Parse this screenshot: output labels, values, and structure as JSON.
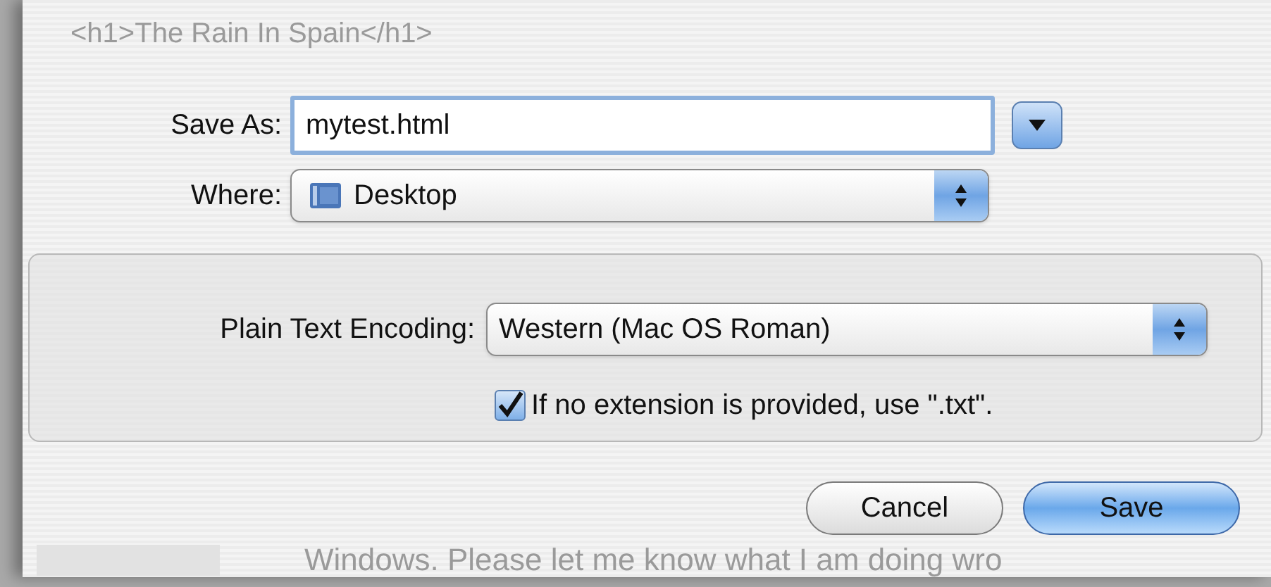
{
  "background_text": {
    "top": "<h1>The Rain In Spain</h1>",
    "bottom": "Windows. Please let me know what I am doing wro"
  },
  "save_as": {
    "label": "Save As:",
    "value": "mytest.html",
    "expanded": false
  },
  "where": {
    "label": "Where:",
    "value": "Desktop"
  },
  "options": {
    "encoding_label": "Plain Text Encoding:",
    "encoding_value": "Western (Mac OS Roman)",
    "extension_checkbox": {
      "label": "If no extension is provided, use \".txt\".",
      "checked": true
    }
  },
  "buttons": [
    {
      "label": "Cancel",
      "kind": "secondary"
    },
    {
      "label": "Save",
      "kind": "default"
    }
  ]
}
